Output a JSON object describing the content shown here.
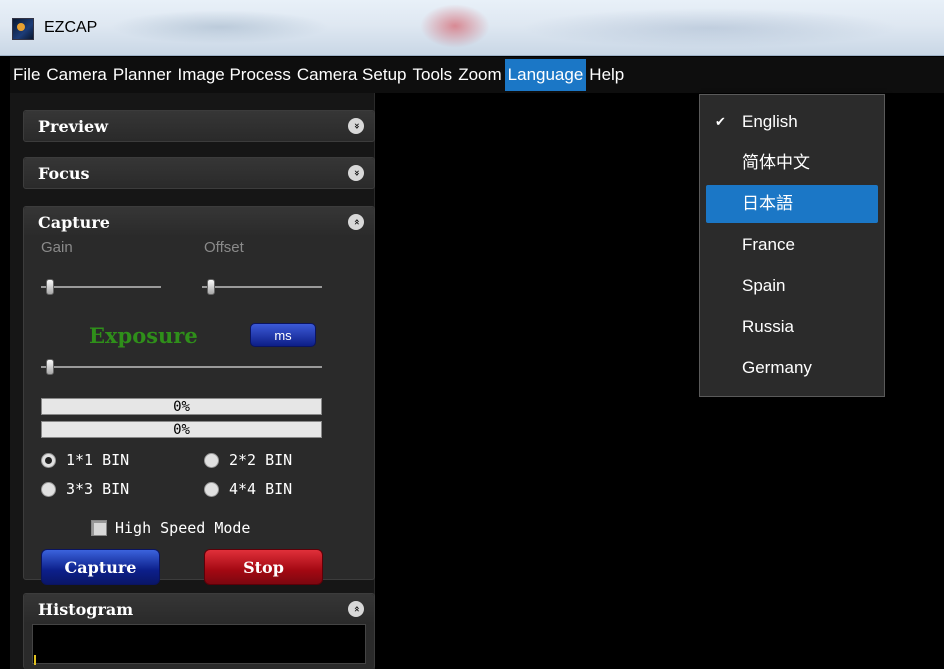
{
  "window": {
    "title": "EZCAP"
  },
  "menubar": {
    "items": [
      "File",
      "Camera",
      "Planner",
      "Image Process",
      "Camera Setup",
      "Tools",
      "Zoom",
      "Language",
      "Help"
    ],
    "active": "Language"
  },
  "panels": {
    "preview": {
      "title": "Preview",
      "toggle": "»"
    },
    "focus": {
      "title": "Focus",
      "toggle": "»"
    },
    "capture": {
      "title": "Capture",
      "toggle": "«",
      "gain_label": "Gain",
      "offset_label": "Offset",
      "exposure_label": "Exposure",
      "unit_button": "ms",
      "progress1": {
        "text": "0%",
        "value": 0
      },
      "progress2": {
        "text": "0%",
        "value": 0
      },
      "bin_options": [
        "1*1 BIN",
        "2*2 BIN",
        "3*3 BIN",
        "4*4 BIN"
      ],
      "bin_selected": "1*1 BIN",
      "high_speed_label": "High Speed Mode",
      "high_speed_checked": false,
      "capture_button": "Capture",
      "stop_button": "Stop"
    },
    "histogram": {
      "title": "Histogram",
      "toggle": "«"
    }
  },
  "language_menu": {
    "items": [
      "English",
      "简体中文",
      "日本語",
      "France",
      "Spain",
      "Russia",
      "Germany"
    ],
    "checked": "English",
    "highlighted": "日本語"
  },
  "colors": {
    "accent": "#1b77c6",
    "exposure_green": "#2f8f1a",
    "capture_blue": "#0c1f8a",
    "stop_red": "#a30812"
  }
}
